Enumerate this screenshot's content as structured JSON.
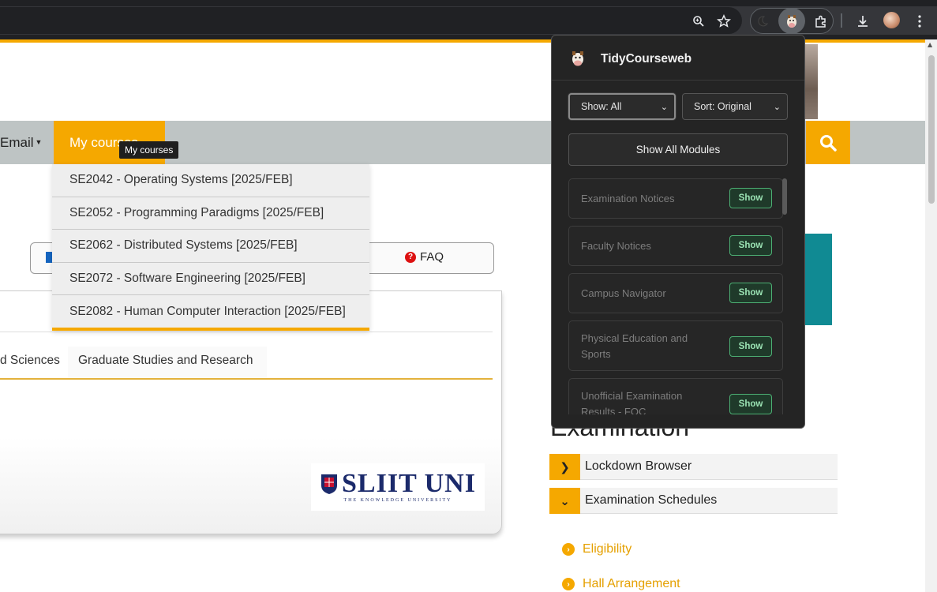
{
  "browser": {
    "icons": [
      "zoom-icon",
      "star-icon",
      "moon-icon",
      "cow-extension-icon",
      "puzzle-icon",
      "download-icon",
      "avatar",
      "more-vert-icon"
    ]
  },
  "nav": {
    "email": "Email",
    "my_courses": "My courses",
    "tooltip": "My courses"
  },
  "courses": [
    "SE2042 - Operating Systems [2025/FEB]",
    "SE2052 - Programming Paradigms [2025/FEB]",
    "SE2062 - Distributed Systems [2025/FEB]",
    "SE2072 - Software Engineering [2025/FEB]",
    "SE2082 - Human Computer Interaction [2025/FEB]"
  ],
  "linkbar": {
    "faq": "FAQ"
  },
  "tabs": {
    "sciences": "d Sciences",
    "graduate": "Graduate Studies and Research"
  },
  "logo": {
    "main": "SLIIT UNI",
    "sub": "THE KNOWLEDGE UNIVERSITY"
  },
  "sidebar": {
    "heading": "Examination",
    "accordion": [
      {
        "label": "Lockdown Browser",
        "state": "collapsed"
      },
      {
        "label": "Examination Schedules",
        "state": "expanded"
      }
    ],
    "links": [
      "Eligibility",
      "Hall Arrangement"
    ]
  },
  "popup": {
    "title": "TidyCourseweb",
    "show_select": "Show: All",
    "sort_select": "Sort: Original",
    "show_all_button": "Show All Modules",
    "modules": [
      {
        "label": "Examination Notices",
        "button": "Show"
      },
      {
        "label": "Faculty Notices",
        "button": "Show"
      },
      {
        "label": "Campus Navigator",
        "button": "Show"
      },
      {
        "label": "Physical Education and Sports",
        "button": "Show"
      },
      {
        "label": "Unofficial Examination Results - FOC",
        "button": "Show"
      }
    ]
  },
  "colors": {
    "accent": "#f5a800",
    "navbar": "#bec4c4",
    "popup_bg": "#242424",
    "show_button": "#4caf73"
  }
}
